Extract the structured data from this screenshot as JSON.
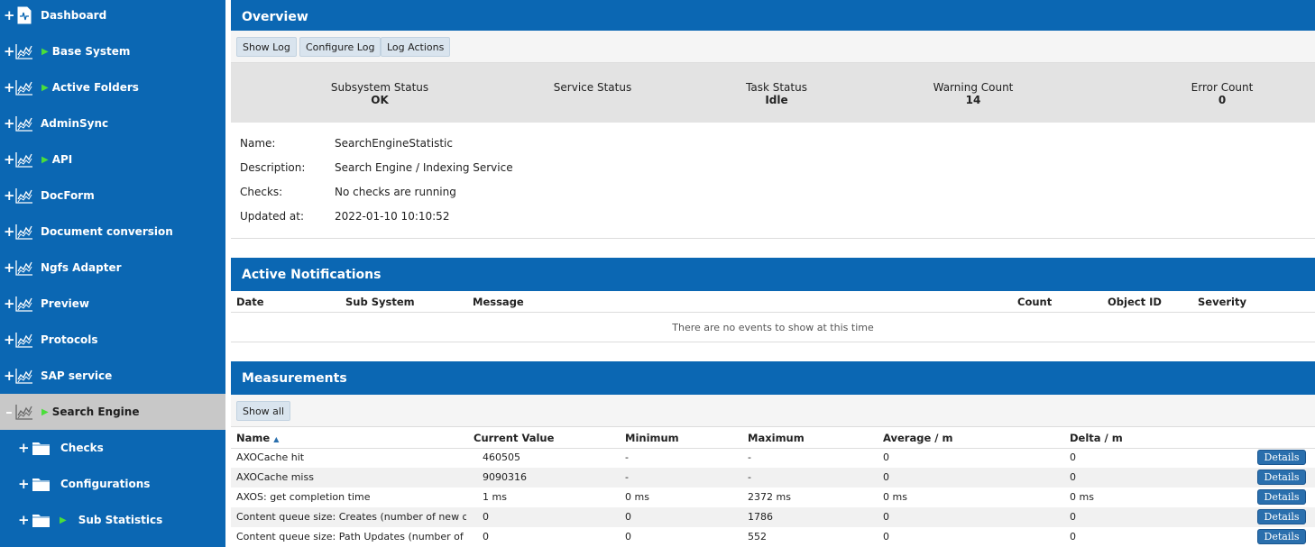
{
  "sidebar": {
    "items": [
      {
        "toggle": "+",
        "icon": "dashboard-icon",
        "arrow": false,
        "label": "Dashboard"
      },
      {
        "toggle": "+",
        "icon": "chart-icon",
        "arrow": true,
        "label": "Base System"
      },
      {
        "toggle": "+",
        "icon": "chart-icon",
        "arrow": true,
        "label": "Active Folders"
      },
      {
        "toggle": "+",
        "icon": "chart-icon",
        "arrow": false,
        "label": "AdminSync"
      },
      {
        "toggle": "+",
        "icon": "chart-icon",
        "arrow": true,
        "label": "API"
      },
      {
        "toggle": "+",
        "icon": "chart-icon",
        "arrow": false,
        "label": "DocForm"
      },
      {
        "toggle": "+",
        "icon": "chart-icon",
        "arrow": false,
        "label": "Document conversion"
      },
      {
        "toggle": "+",
        "icon": "chart-icon",
        "arrow": false,
        "label": "Ngfs Adapter"
      },
      {
        "toggle": "+",
        "icon": "chart-icon",
        "arrow": false,
        "label": "Preview"
      },
      {
        "toggle": "+",
        "icon": "chart-icon",
        "arrow": false,
        "label": "Protocols"
      },
      {
        "toggle": "+",
        "icon": "chart-icon",
        "arrow": false,
        "label": "SAP service"
      },
      {
        "toggle": "–",
        "icon": "chart-icon",
        "arrow": true,
        "label": "Search Engine",
        "selected": true
      },
      {
        "toggle": "+",
        "icon": "folder-icon",
        "arrow": false,
        "label": "Checks",
        "child": true
      },
      {
        "toggle": "+",
        "icon": "folder-icon",
        "arrow": false,
        "label": "Configurations",
        "child": true
      },
      {
        "toggle": "+",
        "icon": "folder-icon",
        "arrow": true,
        "label": "Sub Statistics",
        "child": true
      }
    ]
  },
  "overview": {
    "title": "Overview",
    "buttons": {
      "show_log": "Show Log",
      "configure_log": "Configure Log",
      "log_actions": "Log Actions"
    },
    "status": {
      "subsystem_label": "Subsystem Status",
      "subsystem_value": "OK",
      "service_label": "Service Status",
      "service_value": "",
      "task_label": "Task Status",
      "task_value": "Idle",
      "warning_label": "Warning Count",
      "warning_value": "14",
      "error_label": "Error Count",
      "error_value": "0"
    },
    "info": {
      "name_label": "Name:",
      "name_value": "SearchEngineStatistic",
      "description_label": "Description:",
      "description_value": "Search Engine / Indexing Service",
      "checks_label": "Checks:",
      "checks_value": "No checks are running",
      "updated_label": "Updated at:",
      "updated_value": "2022-01-10 10:10:52"
    }
  },
  "notifications": {
    "title": "Active Notifications",
    "columns": {
      "date": "Date",
      "subsystem": "Sub System",
      "message": "Message",
      "count": "Count",
      "object_id": "Object ID",
      "severity": "Severity"
    },
    "empty_text": "There are no events to show at this time"
  },
  "measurements": {
    "title": "Measurements",
    "show_all": "Show all",
    "sort_indicator": "▲",
    "columns": {
      "name": "Name",
      "current": "Current Value",
      "minimum": "Minimum",
      "maximum": "Maximum",
      "average": "Average / m",
      "delta": "Delta / m"
    },
    "rows": [
      {
        "name": "AXOCache hit",
        "current": "460505",
        "minimum": "-",
        "maximum": "-",
        "average": "0",
        "delta": "0",
        "action": "Details"
      },
      {
        "name": "AXOCache miss",
        "current": "9090316",
        "minimum": "-",
        "maximum": "-",
        "average": "0",
        "delta": "0",
        "action": "Details"
      },
      {
        "name": "AXOS: get completion time",
        "current": "1 ms",
        "minimum": "0 ms",
        "maximum": "2372 ms",
        "average": "0 ms",
        "delta": "0 ms",
        "action": "Details"
      },
      {
        "name": "Content queue size: Creates (number of new obj...",
        "current": "0",
        "minimum": "0",
        "maximum": "1786",
        "average": "0",
        "delta": "0",
        "action": "Details"
      },
      {
        "name": "Content queue size: Path Updates (number of rei...",
        "current": "0",
        "minimum": "0",
        "maximum": "552",
        "average": "0",
        "delta": "0",
        "action": "Details"
      }
    ]
  },
  "colors": {
    "primary": "#0b67b3",
    "selected": "#c8c8c8",
    "arrow": "#4ade3a"
  }
}
